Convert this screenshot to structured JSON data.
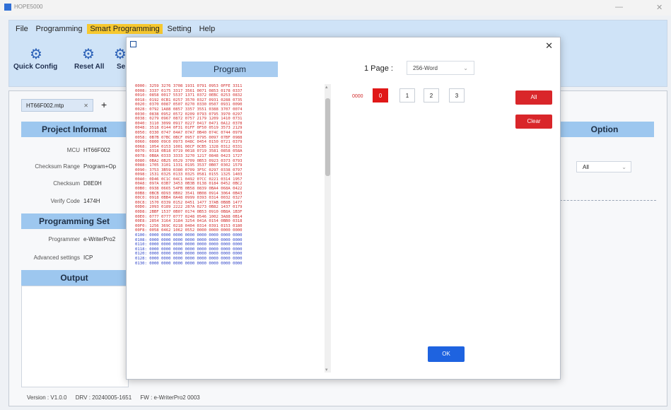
{
  "app": {
    "title": "HOPE5000"
  },
  "menu": [
    "File",
    "Programming",
    "Smart Programming",
    "Setting",
    "Help"
  ],
  "ribbon": {
    "buttons": [
      "Quick Config",
      "Reset All",
      "Se"
    ]
  },
  "project_tab": {
    "label": "HT66F002.mtp",
    "close": "✕",
    "add": "+"
  },
  "project_info": {
    "header": "Project Informat",
    "rows": [
      {
        "label": "MCU",
        "value": "HT66F002"
      },
      {
        "label": "Checksum Range",
        "value": "Program+Op"
      },
      {
        "label": "Checksum",
        "value": "D8E0H"
      },
      {
        "label": "Verify Code",
        "value": "1474H"
      }
    ]
  },
  "programming_settings": {
    "header": "Programming Set",
    "rows": [
      {
        "label": "Programmer",
        "value": "e-WriterPro2"
      },
      {
        "label": "Advanced settings",
        "value": "ICP"
      }
    ]
  },
  "output": {
    "header": "Output"
  },
  "option": {
    "header": "Option",
    "select_value": "All"
  },
  "statusbar": {
    "version": "Version : V1.0.0",
    "drv": "DRV : 20240005-1651",
    "fw": "FW : e-WriterPro2 0003"
  },
  "dialog": {
    "program_header": "Program",
    "page_label": "1 Page :",
    "page_select": "256-Word",
    "addr_label": "0000",
    "page_buttons": [
      "0",
      "1",
      "2",
      "3"
    ],
    "all_button": "All",
    "clear_button": "Clear",
    "ok_button": "OK",
    "hex_rows": [
      "0000: 3259 3276 3708 1931 0791 0953 0FFE 3311",
      "0008: 3337 0175 3317 3561 0071 0853 0178 0337",
      "0010: 0858 0017 5537 1371 0372 0EBC 0253 0832",
      "0018: 0192 0CB1 0257 3570 0327 0931 0288 0735",
      "0020: 0370 0087 0507 0270 0330 0507 0931 0090",
      "0028: 0792 1A88 0857 3357 3551 0388 3707 0074",
      "0030: 0838 0952 0572 0209 0793 0795 3970 0297",
      "0038: 0279 0967 0872 0757 2179 1209 1410 0731",
      "0040: 3110 3099 0917 0227 0417 0471 0A12 0378",
      "0048: 3518 0144 0F31 01FF 0F50 0519 3573 2129",
      "0050: 0330 0747 04A7 07A7 0B40 074C 0744 0979",
      "0058: 0B7B 07BC 0BCF 0957 0795 0097 07BF 0988",
      "0060: 0800 09C0 0973 048C 0454 0150 0721 0379",
      "0068: 1054 0153 1001 00CF 0CB5 1328 0312 0331",
      "0070: 0318 0B18 0719 0018 0719 3581 0858 058A",
      "0078: 0B8A 0333 3333 3270 1217 0848 0423 1727",
      "0080: 0BA2 0B25 0529 3709 0B53 0923 0373 0793",
      "0088: 1705 3101 1331 0195 3537 0B07 0302 1579",
      "0090: 3753 3B59 0380 0709 3F5C 0297 0338 0797",
      "0098: 1531 0325 0133 0325 0581 0155 1325 1403",
      "00A0: 0D46 0C1C 04C1 0492 07CC 0221 0314 1957",
      "00A8: 097A 03B7 3453 0B3B 0138 0184 0452 0BC2",
      "00B0: 0938 0665 54FB 0B58 0839 0BA4 068A 0422",
      "00B8: 0BCB 0D93 0B02 3541 0B08 0914 3064 0B43",
      "00C0: 0918 0BB4 0A48 0999 0393 0314 0032 0327",
      "00C8: 1570 0339 0152 0451 1477 37AB 0B8B 1477",
      "00D0: 2093 0189 2222 287A 0273 0B82 1437 0179",
      "00D8: 2BBF 1537 0B07 0174 0B53 0910 0B8A 1B3F",
      "00E0: 0777 0777 0777 0248 0546 1002 3A88 0B14",
      "00E8: 2854 3164 3184 3254 041A 0154 0BB0 0318",
      "00F0: 1256 369C 0218 0404 0314 0391 0153 0180",
      "00F8: 0058 0462 1062 0552 0000 0000 0000 0000",
      "0100: 0000 0000 0000 0000 0000 0000 0000 0000",
      "0108: 0000 0000 0000 0000 0000 0000 0000 0000",
      "0110: 0000 0000 0000 0000 0000 0000 0000 0000",
      "0118: 0000 0000 0000 0000 0000 0000 0000 0000",
      "0120: 0000 0000 0000 0000 0000 0000 0000 0000",
      "0128: 0000 0000 0000 0000 0000 0000 0000 0000",
      "0130: 0000 0000 0000 0000 0000 0000 0000 0000"
    ],
    "hex_programmed_rows": 32
  },
  "colors": {
    "accent_red": "#e01818",
    "ok_blue": "#1e63e0",
    "header_blue": "#a8ccf0",
    "menu_highlight": "#f6c82f"
  }
}
